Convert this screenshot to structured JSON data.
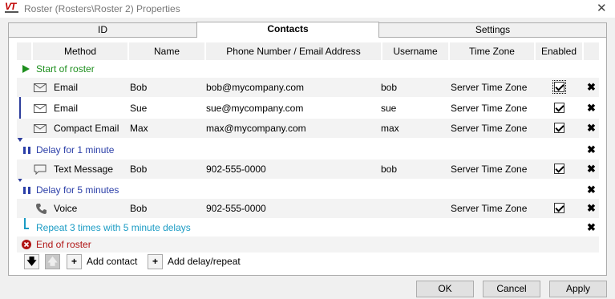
{
  "window": {
    "title": "Roster (Rosters\\Roster 2) Properties",
    "logo_text": "VT"
  },
  "tabs": [
    {
      "label": "ID"
    },
    {
      "label": "Contacts"
    },
    {
      "label": "Settings"
    }
  ],
  "columns": {
    "method": "Method",
    "name": "Name",
    "phone": "Phone Number / Email Address",
    "username": "Username",
    "timezone": "Time Zone",
    "enabled": "Enabled"
  },
  "start_label": "Start of roster",
  "rows": [
    {
      "method": "Email",
      "name": "Bob",
      "address": "bob@mycompany.com",
      "username": "bob",
      "timezone": "Server Time Zone",
      "enabled": true,
      "icon": "envelope-icon"
    },
    {
      "method": "Email",
      "name": "Sue",
      "address": "sue@mycompany.com",
      "username": "sue",
      "timezone": "Server Time Zone",
      "enabled": true,
      "icon": "envelope-icon"
    },
    {
      "method": "Compact Email",
      "name": "Max",
      "address": "max@mycompany.com",
      "username": "max",
      "timezone": "Server Time Zone",
      "enabled": true,
      "icon": "envelope-icon"
    },
    {
      "method": "Text Message",
      "name": "Bob",
      "address": "902-555-0000",
      "username": "bob",
      "timezone": "Server Time Zone",
      "enabled": true,
      "icon": "speech-bubble-icon"
    },
    {
      "method": "Voice",
      "name": "Bob",
      "address": "902-555-0000",
      "username": "",
      "timezone": "Server Time Zone",
      "enabled": true,
      "icon": "phone-icon"
    }
  ],
  "delays": [
    {
      "label": "Delay for 1 minute"
    },
    {
      "label": "Delay for 5 minutes"
    }
  ],
  "repeat_label": "Repeat 3 times with 5 minute delays",
  "end_label": "End of roster",
  "toolbar": {
    "add_contact": "Add contact",
    "add_delay": "Add delay/repeat"
  },
  "buttons": {
    "ok": "OK",
    "cancel": "Cancel",
    "apply": "Apply"
  },
  "colors": {
    "start": "#1e8f1e",
    "delay": "#2b3fa8",
    "repeat": "#1a9bc4",
    "end": "#b01515"
  }
}
